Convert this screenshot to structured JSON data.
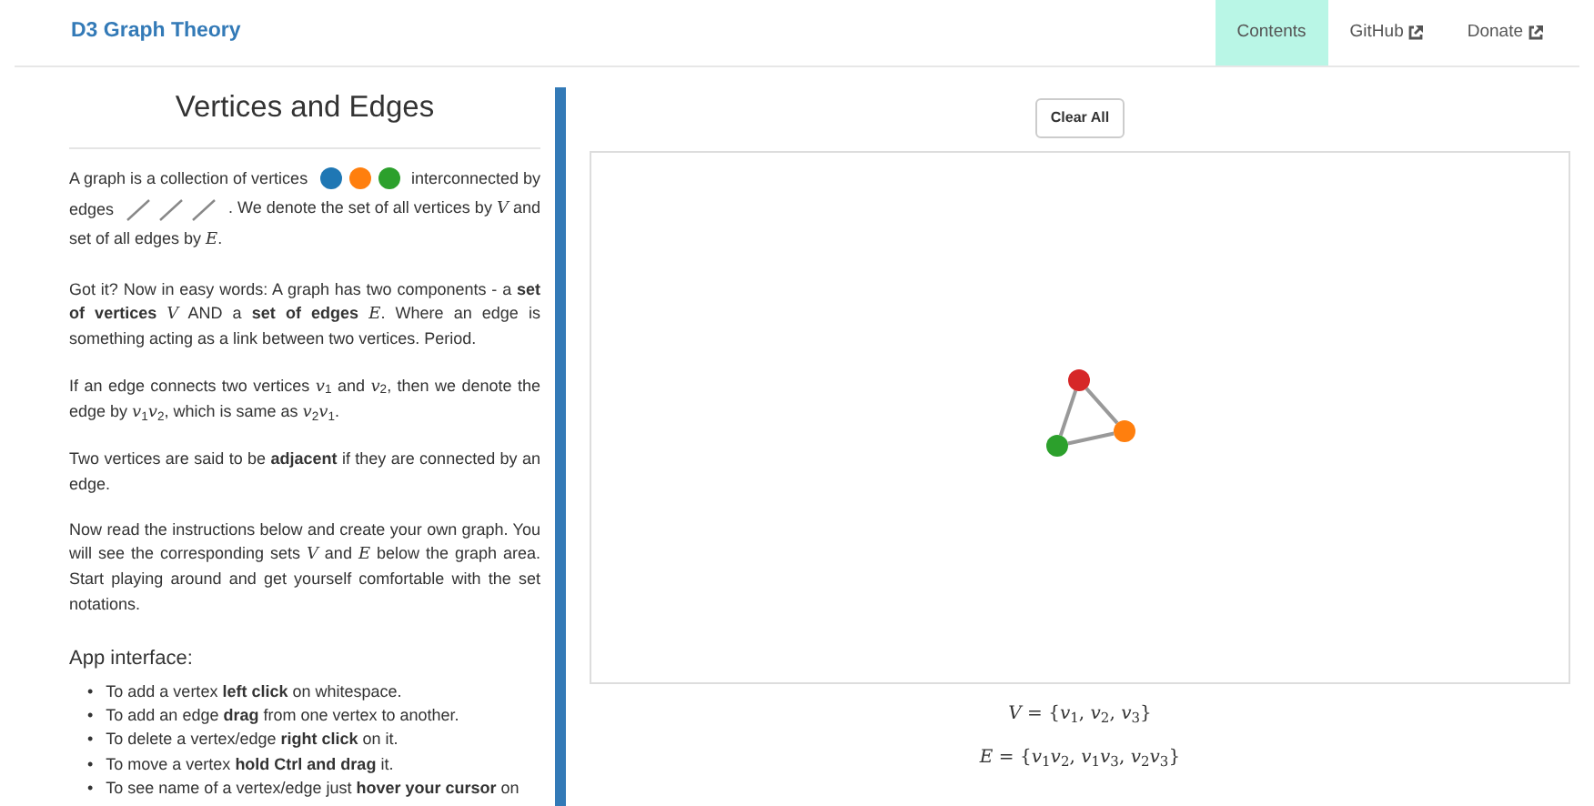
{
  "navbar": {
    "brand": "D3 Graph Theory",
    "links": [
      {
        "label": "Contents",
        "selected": true,
        "external": false
      },
      {
        "label": "GitHub",
        "selected": false,
        "external": true
      },
      {
        "label": "Donate",
        "selected": false,
        "external": true
      }
    ]
  },
  "sidebar": {
    "title": "Vertices and Edges",
    "intro_lines": [
      [
        {
          "kind": "text",
          "text": "A graph is a collection of vertices"
        },
        {
          "kind": "vertex_dots"
        },
        {
          "kind": "text",
          "text": "interconnected by"
        }
      ],
      [
        {
          "kind": "text",
          "text": "edges"
        },
        {
          "kind": "edge_lines"
        },
        {
          "kind": "text",
          "text": ". We denote the set of all vertices by *V* and"
        }
      ],
      [
        {
          "kind": "text",
          "text": "set of all edges by *E*."
        }
      ]
    ],
    "paragraphs": [
      "Got it? Now in easy words: A graph has two components - a **set of vertices** *V* AND a **set of edges** *E*. Where an edge is something acting as a link between two vertices. Period.",
      "If an edge connects two vertices *v*$_{1}$ and *v*$_{2}$, then we denote the edge by *v*$_{1}$*v*$_{2}$, which is same as *v*$_{2}$*v*$_{1}$.",
      "Two vertices are said to be **adjacent** if they are connected by an edge.",
      "Now read the instructions below and create your own graph. You will see the corresponding sets *V* and *E* below the graph area. Start playing around and get yourself comfortable with the set notations."
    ],
    "subheading": "App interface:",
    "instructions": [
      {
        "bullet": "•",
        "text": "To add a vertex **left click** on whitespace."
      },
      {
        "bullet": "•",
        "text": "To add an edge **drag** from one vertex to another."
      },
      {
        "bullet": "•",
        "text": "To delete a vertex/edge **right click** on it."
      },
      {
        "bullet": "•",
        "text": "To move a vertex **hold Ctrl and drag** it."
      },
      {
        "bullet": "•",
        "text": "To see name of a vertex/edge just **hover your cursor** on"
      }
    ]
  },
  "graph": {
    "clear_button": "Clear All",
    "vertices": [
      {
        "color": "#d62728"
      },
      {
        "color": "#ff7f0e"
      },
      {
        "color": "#2ca02c"
      }
    ],
    "vertex_set": "*V* = {*v*$_{1}$, *v*$_{2}$, *v*$_{3}$}",
    "edge_set": "*E* = {*v*$_{1}$*v*$_{2}$, *v*$_{1}$*v*$_{3}$, *v*$_{2}$*v*$_{3}$}"
  }
}
